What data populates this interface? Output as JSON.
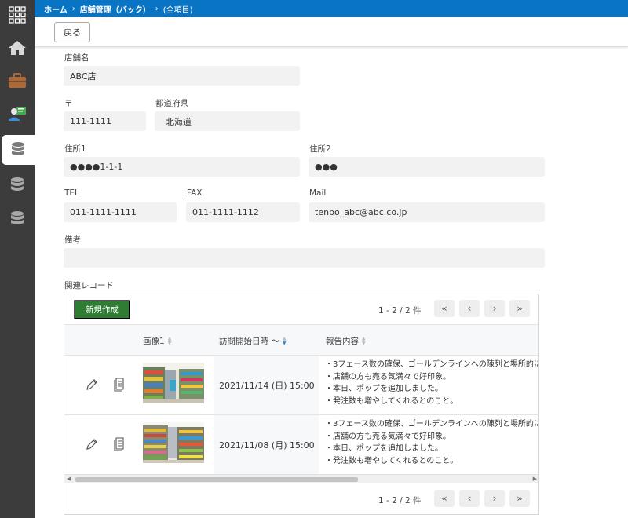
{
  "breadcrumb": {
    "home": "ホーム",
    "section": "店舗管理（バック）",
    "view": "(全項目)"
  },
  "toolbar": {
    "back_label": "戻る"
  },
  "form": {
    "store_name_label": "店舗名",
    "store_name": "ABC店",
    "postal_label": "〒",
    "postal": "111-1111",
    "prefecture_label": "都道府県",
    "prefecture": "北海道",
    "address1_label": "住所1",
    "address1": "●●●●1-1-1",
    "address2_label": "住所2",
    "address2": "●●●",
    "tel_label": "TEL",
    "tel": "011-1111-1111",
    "fax_label": "FAX",
    "fax": "011-1111-1112",
    "mail_label": "Mail",
    "mail": "tenpo_abc@abc.co.jp",
    "notes_label": "備考",
    "notes": ""
  },
  "related": {
    "label": "関連レコード",
    "new_button": "新規作成",
    "pager_text": "1 - 2 / 2 件",
    "columns": {
      "image": "画像1",
      "visit_date": "訪問開始日時 〜",
      "report": "報告内容"
    },
    "rows": [
      {
        "date": "2021/11/14 (日) 15:00",
        "report_lines": [
          "・3フェース数の確保、ゴールデンラインへの陳列と場所的によ",
          "・店舗の方も売る気満々で好印象。",
          "・本日、ポップを追加しました。",
          "・発注数も増やしてくれるとのこと。"
        ]
      },
      {
        "date": "2021/11/08 (月) 15:00",
        "report_lines": [
          "・3フェース数の確保、ゴールデンラインへの陳列と場所的によ",
          "・店舗の方も売る気満々で好印象。",
          "・本日、ポップを追加しました。",
          "・発注数も増やしてくれるとのこと。"
        ]
      }
    ]
  },
  "colors": {
    "topbar": "#0a74c4",
    "sidebar": "#3c3c3c",
    "new_button": "#2e7d32"
  },
  "icons": [
    "apps-grid-icon",
    "home-icon",
    "briefcase-icon",
    "user-card-icon",
    "database-icon",
    "edit-pencil-icon",
    "document-icon",
    "chevron-first-icon",
    "chevron-left-icon",
    "chevron-right-icon",
    "chevron-last-icon"
  ]
}
